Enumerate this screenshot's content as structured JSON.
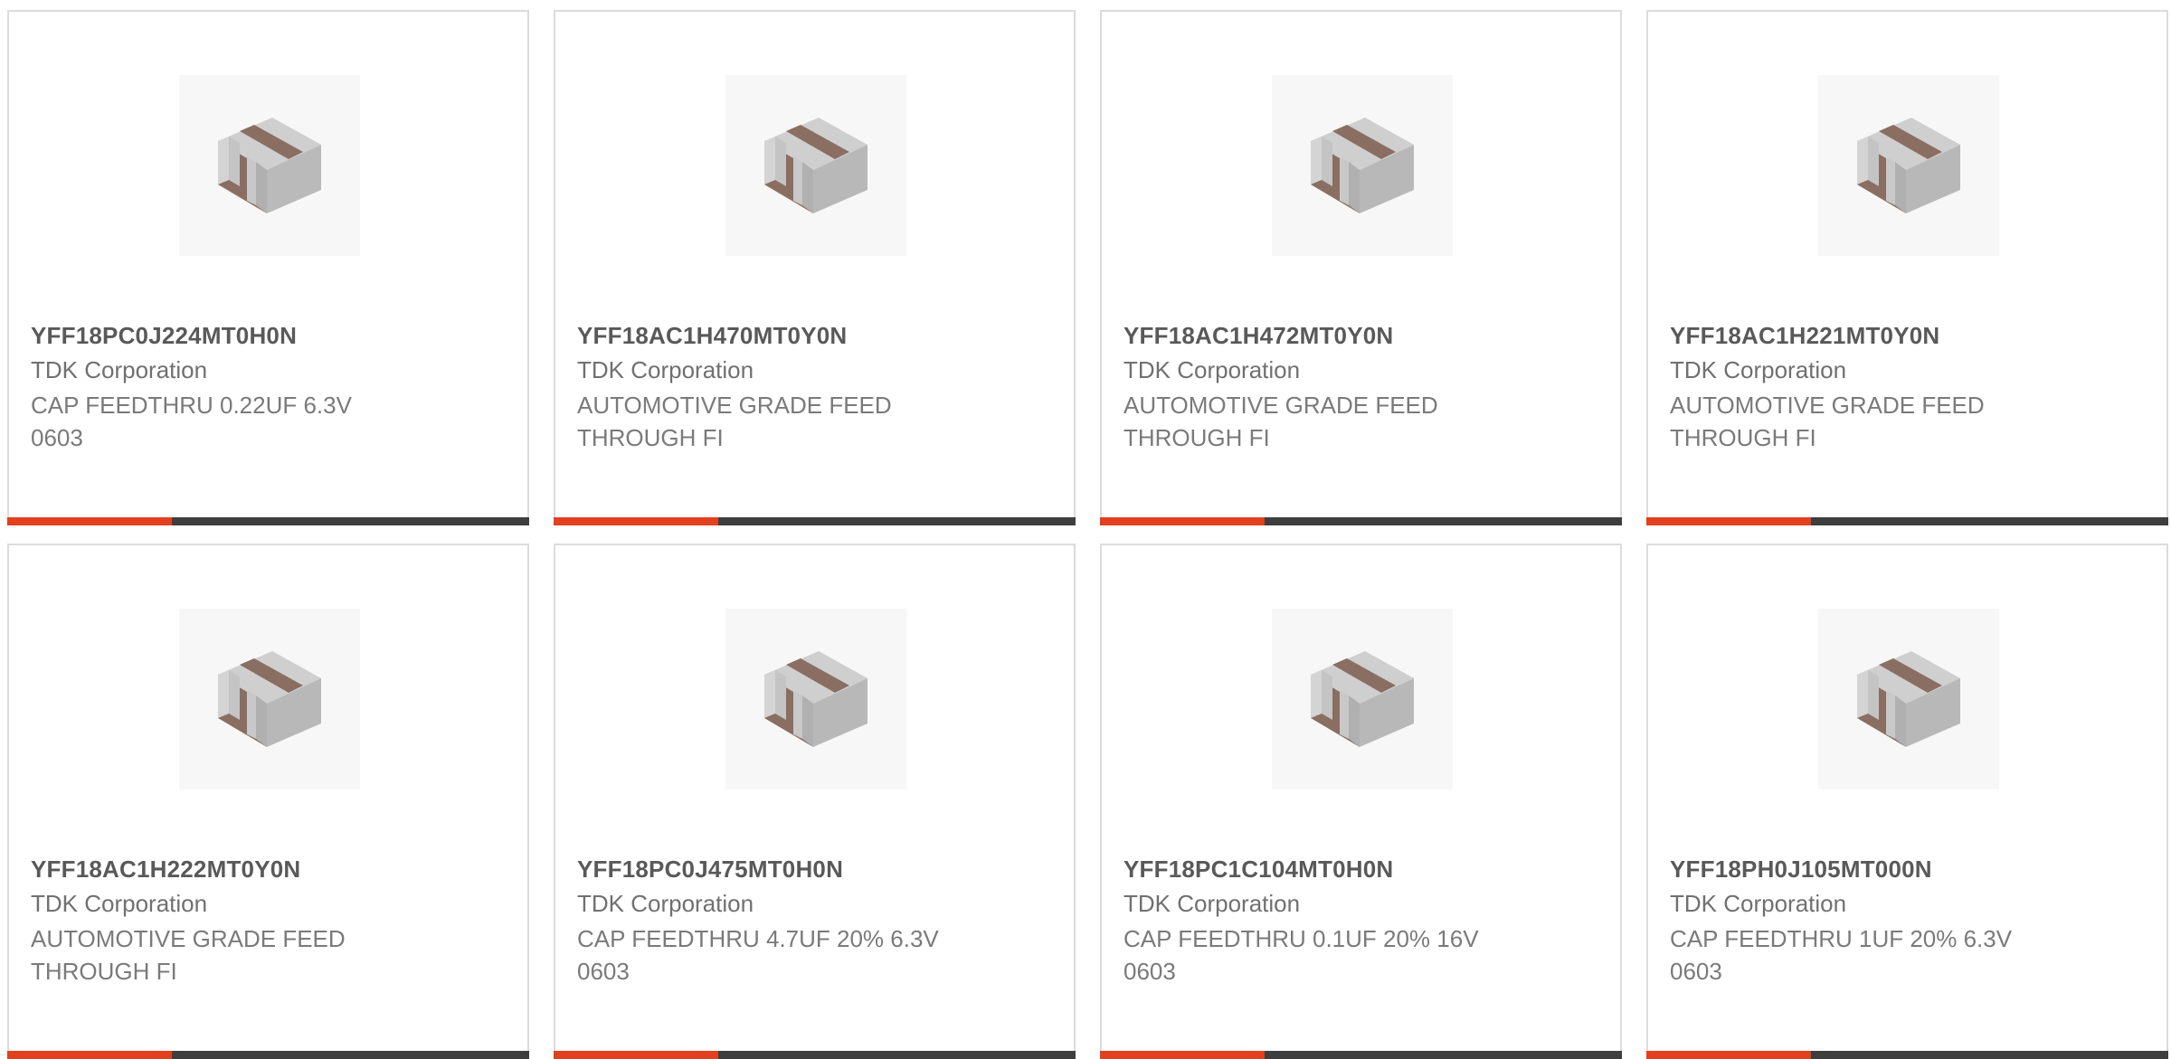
{
  "colors": {
    "accent": "#e2401f",
    "bar_dark": "#3e3e3e",
    "card_border": "#dcdcdc",
    "title_text": "#595959",
    "body_text": "#707070"
  },
  "products": [
    {
      "part_number": "YFF18PC0J224MT0H0N",
      "manufacturer": "TDK Corporation",
      "description": "CAP FEEDTHRU 0.22UF 6.3V 0603",
      "image_icon": "chip-capacitor-image"
    },
    {
      "part_number": "YFF18AC1H470MT0Y0N",
      "manufacturer": "TDK Corporation",
      "description": "AUTOMOTIVE GRADE FEED THROUGH FI",
      "image_icon": "chip-capacitor-image"
    },
    {
      "part_number": "YFF18AC1H472MT0Y0N",
      "manufacturer": "TDK Corporation",
      "description": "AUTOMOTIVE GRADE FEED THROUGH FI",
      "image_icon": "chip-capacitor-image"
    },
    {
      "part_number": "YFF18AC1H221MT0Y0N",
      "manufacturer": "TDK Corporation",
      "description": "AUTOMOTIVE GRADE FEED THROUGH FI",
      "image_icon": "chip-capacitor-image"
    },
    {
      "part_number": "YFF18AC1H222MT0Y0N",
      "manufacturer": "TDK Corporation",
      "description": "AUTOMOTIVE GRADE FEED THROUGH FI",
      "image_icon": "chip-capacitor-image"
    },
    {
      "part_number": "YFF18PC0J475MT0H0N",
      "manufacturer": "TDK Corporation",
      "description": "CAP FEEDTHRU 4.7UF 20% 6.3V 0603",
      "image_icon": "chip-capacitor-image"
    },
    {
      "part_number": "YFF18PC1C104MT0H0N",
      "manufacturer": "TDK Corporation",
      "description": "CAP FEEDTHRU 0.1UF 20% 16V 0603",
      "image_icon": "chip-capacitor-image"
    },
    {
      "part_number": "YFF18PH0J105MT000N",
      "manufacturer": "TDK Corporation",
      "description": "CAP FEEDTHRU 1UF 20% 6.3V 0603",
      "image_icon": "chip-capacitor-image"
    }
  ]
}
